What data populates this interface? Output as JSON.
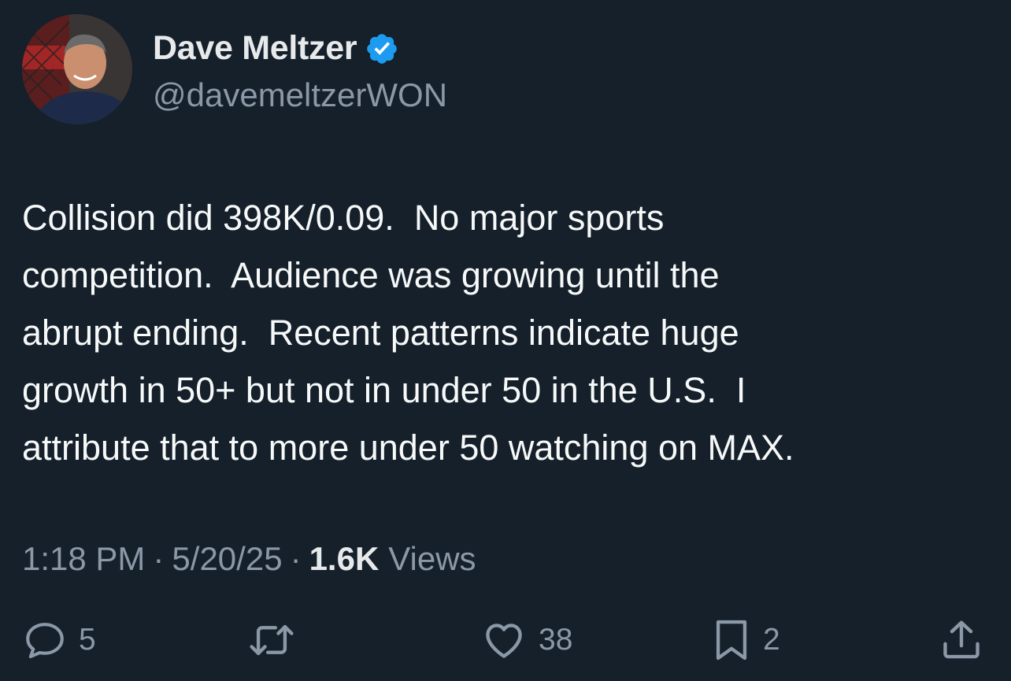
{
  "author": {
    "display_name": "Dave Meltzer",
    "handle": "@davemeltzerWON",
    "verified": true,
    "verified_color": "#1d9bf0"
  },
  "tweet": {
    "text": "Collision did 398K/0.09.  No major sports\ncompetition.  Audience was growing until the\nabrupt ending.  Recent patterns indicate huge\ngrowth in 50+ but not in under 50 in the U.S.  I\nattribute that to more under 50 watching on MAX.",
    "time": "1:18 PM",
    "date": "5/20/25",
    "views_count": "1.6K",
    "views_label": "Views"
  },
  "actions": {
    "reply": {
      "icon": "reply-icon",
      "count": "5"
    },
    "retweet": {
      "icon": "retweet-icon",
      "count": ""
    },
    "like": {
      "icon": "heart-icon",
      "count": "38"
    },
    "bookmark": {
      "icon": "bookmark-icon",
      "count": "2"
    },
    "share": {
      "icon": "share-icon"
    }
  },
  "colors": {
    "background": "#15202b",
    "text": "#e7e9ea",
    "muted": "#8b98a5"
  }
}
